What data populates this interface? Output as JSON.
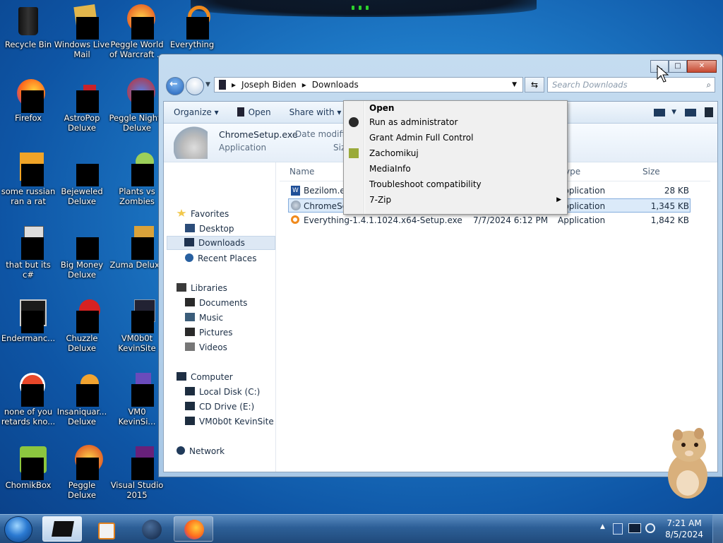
{
  "desktop": {
    "icons": [
      {
        "label": "Recycle Bin"
      },
      {
        "label": "Windows Live Mail"
      },
      {
        "label": "Peggle World of Warcraft ..."
      },
      {
        "label": "Everything"
      },
      {
        "label": "Firefox"
      },
      {
        "label": "AstroPop Deluxe"
      },
      {
        "label": "Peggle Nights Deluxe"
      },
      {
        "label": "some russian ran a rat"
      },
      {
        "label": "Bejeweled Deluxe"
      },
      {
        "label": "Plants vs Zombies"
      },
      {
        "label": "that but its c#"
      },
      {
        "label": "Big Money Deluxe"
      },
      {
        "label": "Zuma Deluxe"
      },
      {
        "label": "Endermanc..."
      },
      {
        "label": "Chuzzle Deluxe"
      },
      {
        "label": "VM0b0t KevinSite"
      },
      {
        "label": "none of you retards kno..."
      },
      {
        "label": "Insaniquar... Deluxe"
      },
      {
        "label": "VM0 KevinSi..."
      },
      {
        "label": "ChomikBox"
      },
      {
        "label": "Peggle Deluxe"
      },
      {
        "label": "Visual Studio 2015"
      }
    ]
  },
  "explorer": {
    "breadcrumb": [
      "Joseph Biden",
      "Downloads"
    ],
    "search_placeholder": "Search Downloads",
    "toolbar": {
      "organize": "Organize",
      "open": "Open",
      "share_with": "Share with"
    },
    "preview": {
      "filename": "ChromeSetup.exe",
      "type": "Application",
      "date_label": "Date modified",
      "size_label": "Siz"
    },
    "nav": {
      "favorites": "Favorites",
      "desktop": "Desktop",
      "downloads": "Downloads",
      "recent": "Recent Places",
      "libraries": "Libraries",
      "documents": "Documents",
      "music": "Music",
      "pictures": "Pictures",
      "videos": "Videos",
      "computer": "Computer",
      "local_disk": "Local Disk (C:)",
      "cd_drive": "CD Drive (E:)",
      "vm_drive": "VM0b0t KevinSite",
      "network": "Network"
    },
    "columns": {
      "name": "Name",
      "type": "ype",
      "size": "Size"
    },
    "files": [
      {
        "name": "Bezilom.exe",
        "date": "",
        "type": "Application",
        "size": "28 KB"
      },
      {
        "name": "ChromeSetup.exe",
        "date": "",
        "type": "Application",
        "size": "1,345 KB"
      },
      {
        "name": "Everything-1.4.1.1024.x64-Setup.exe",
        "date": "7/7/2024 6:12 PM",
        "type": "Application",
        "size": "1,842 KB"
      }
    ]
  },
  "context_menu": {
    "items": [
      {
        "label": "Open"
      },
      {
        "label": "Run as administrator"
      },
      {
        "label": "Grant Admin Full Control"
      },
      {
        "label": "Zachomikuj"
      },
      {
        "label": "MediaInfo"
      },
      {
        "label": "Troubleshoot compatibility"
      },
      {
        "label": "7-Zip"
      }
    ]
  },
  "taskbar": {
    "time": "7:21 AM",
    "date": "8/5/2024"
  },
  "colors": {
    "desktop_bg": "#1f7cc9",
    "taskbar": "#2d5f97",
    "selection": "#dbeaf9",
    "close_btn": "#c74a32"
  }
}
